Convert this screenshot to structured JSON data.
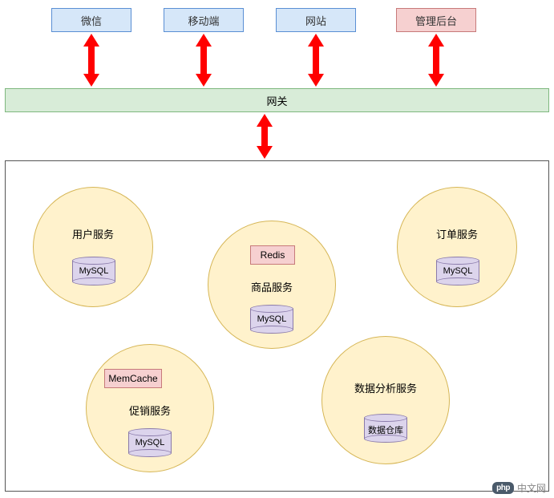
{
  "clients": {
    "wechat": "微信",
    "mobile": "移动端",
    "website": "网站",
    "admin": "管理后台"
  },
  "gateway": "网关",
  "services": {
    "user": {
      "title": "用户服务",
      "db": "MySQL"
    },
    "product": {
      "title": "商品服务",
      "cache": "Redis",
      "db": "MySQL"
    },
    "order": {
      "title": "订单服务",
      "db": "MySQL"
    },
    "promotion": {
      "title": "促销服务",
      "cache": "MemCache",
      "db": "MySQL"
    },
    "analytics": {
      "title": "数据分析服务",
      "db": "数据仓库"
    }
  },
  "watermark": {
    "logo": "php",
    "text": "中文网"
  },
  "colors": {
    "client_fill": "#d6e7f9",
    "client_border": "#5a8fd4",
    "admin_fill": "#f6d0d0",
    "admin_border": "#c77a7a",
    "gateway_fill": "#d8ecd8",
    "gateway_border": "#7fb87f",
    "circle_fill": "#fff2cc",
    "circle_border": "#d6b656",
    "db_fill": "#dcd4ec",
    "db_border": "#8a7aaa",
    "arrow": "#ff0000"
  }
}
